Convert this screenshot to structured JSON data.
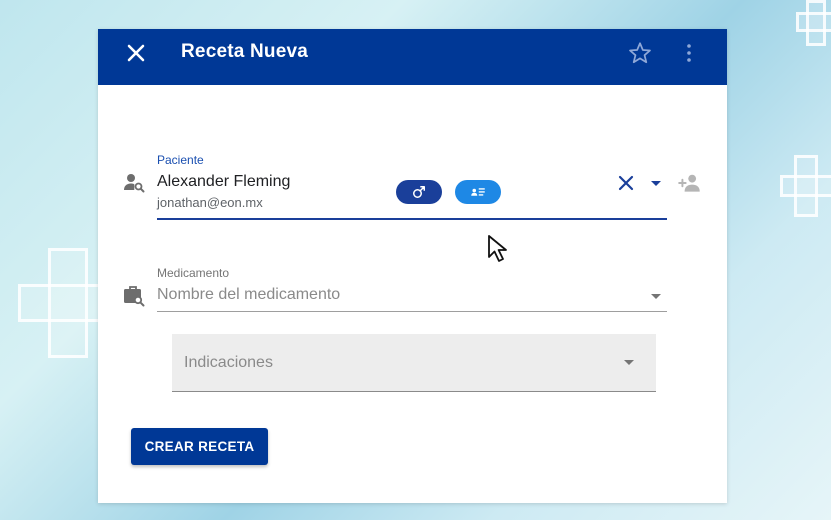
{
  "colors": {
    "primary": "#003896",
    "chip_gender": "#1a3f9a",
    "chip_card": "#1e88e5"
  },
  "header": {
    "title": "Receta Nueva",
    "close_icon": "close-icon",
    "star_icon": "star-icon",
    "more_icon": "more-vert-icon"
  },
  "patient": {
    "label": "Paciente",
    "name": "Alexander Fleming",
    "email": "jonathan@eon.mx",
    "chips": [
      "male-icon",
      "id-card-icon"
    ]
  },
  "medication": {
    "label": "Medicamento",
    "placeholder": "Nombre del medicamento"
  },
  "indications": {
    "placeholder": "Indicaciones"
  },
  "actions": {
    "create_label": "CREAR RECETA"
  }
}
